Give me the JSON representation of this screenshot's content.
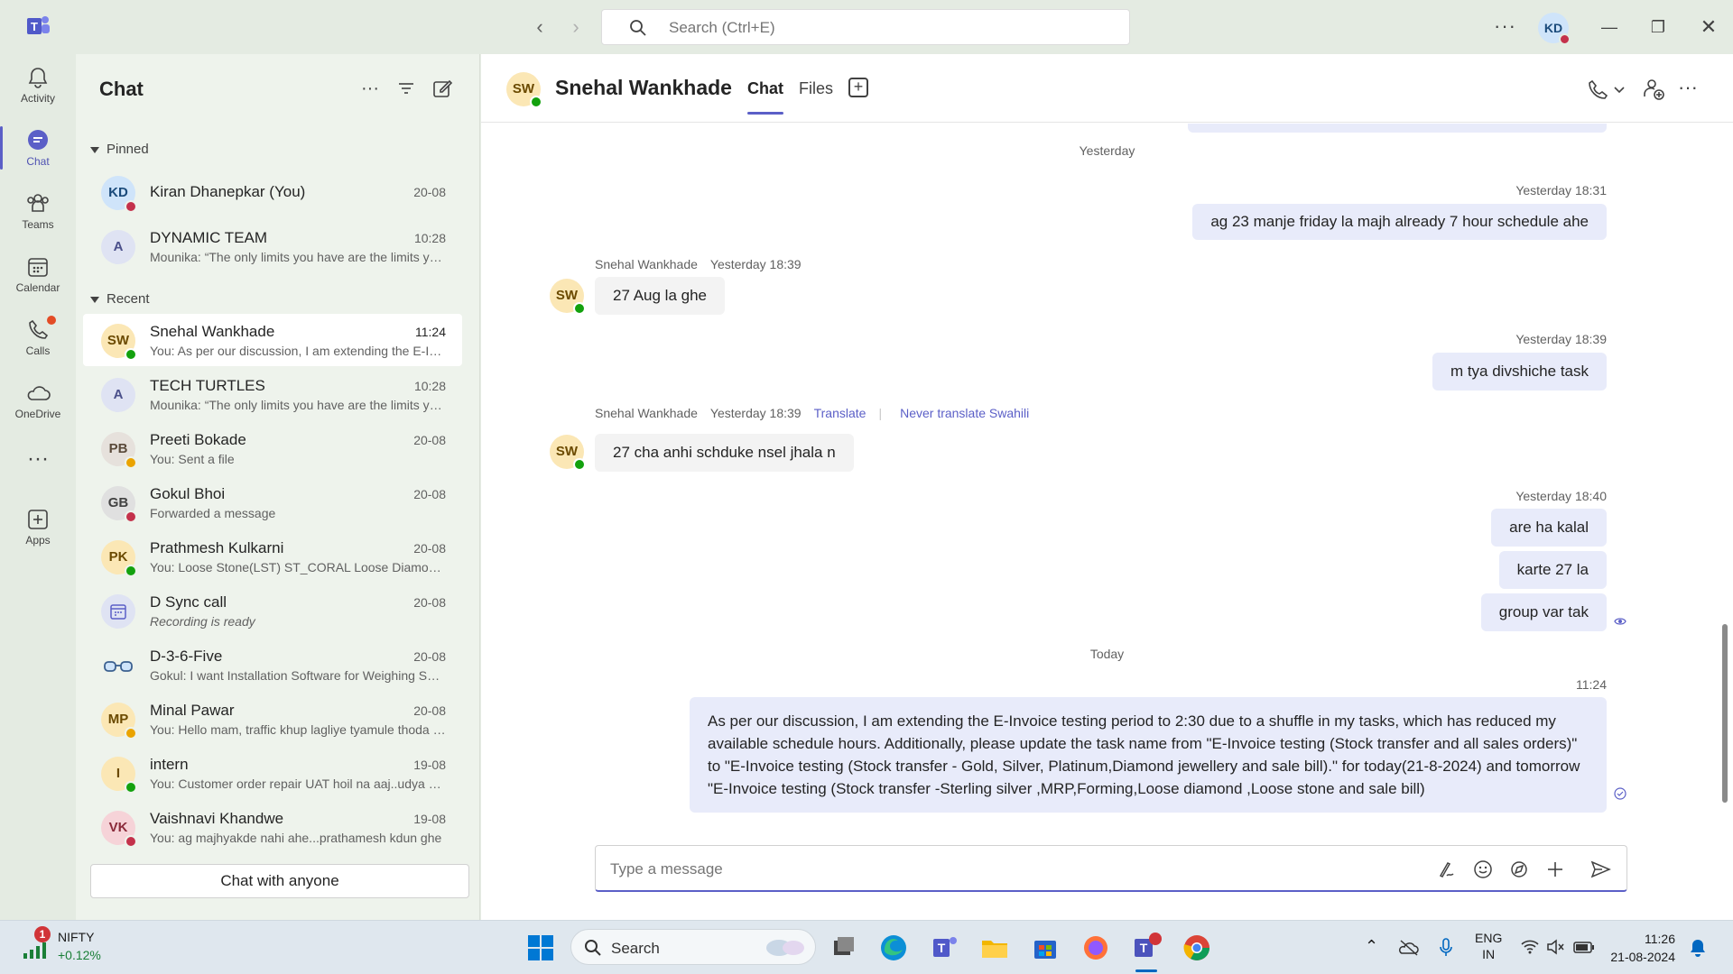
{
  "titlebar": {
    "search_placeholder": "Search (Ctrl+E)",
    "user_initials": "KD"
  },
  "rail": [
    {
      "label": "Activity",
      "icon": "bell-icon"
    },
    {
      "label": "Chat",
      "icon": "chat-icon"
    },
    {
      "label": "Teams",
      "icon": "teams-icon"
    },
    {
      "label": "Calendar",
      "icon": "calendar-icon"
    },
    {
      "label": "Calls",
      "icon": "phone-icon"
    },
    {
      "label": "OneDrive",
      "icon": "cloud-icon"
    },
    {
      "label": "Apps",
      "icon": "apps-icon"
    }
  ],
  "chatlist": {
    "title": "Chat",
    "pinned_label": "Pinned",
    "recent_label": "Recent",
    "chat_anyone": "Chat with anyone",
    "pinned": [
      {
        "initials": "KD",
        "name": "Kiran Dhanepkar (You)",
        "time": "20-08",
        "preview": ""
      },
      {
        "initials": "A",
        "name": "DYNAMIC TEAM",
        "time": "10:28",
        "preview": "Mounika: “The only limits you have are the limits you believe”"
      }
    ],
    "recent": [
      {
        "initials": "SW",
        "name": "Snehal Wankhade",
        "time": "11:24",
        "preview": "You: As per our discussion, I am extending the E-Invoice testing"
      },
      {
        "initials": "A",
        "name": "TECH TURTLES",
        "time": "10:28",
        "preview": "Mounika: “The only limits you have are the limits you believe”"
      },
      {
        "initials": "PB",
        "name": "Preeti Bokade",
        "time": "20-08",
        "preview": "You: Sent a file"
      },
      {
        "initials": "GB",
        "name": "Gokul Bhoi",
        "time": "20-08",
        "preview": "Forwarded a message"
      },
      {
        "initials": "PK",
        "name": "Prathmesh Kulkarni",
        "time": "20-08",
        "preview": "You: Loose Stone(LST) ST_CORAL Loose Diamond(LDM) ST_DIA"
      },
      {
        "initials": "",
        "name": "D Sync call",
        "time": "20-08",
        "preview": "Recording is ready"
      },
      {
        "initials": "",
        "name": "D-3-6-Five",
        "time": "20-08",
        "preview": "Gokul: I want Installation Software for Weighing Scale"
      },
      {
        "initials": "MP",
        "name": "Minal Pawar",
        "time": "20-08",
        "preview": "You: Hello mam, traffic khup lagliye tyamule thoda late hoil"
      },
      {
        "initials": "I",
        "name": "intern",
        "time": "19-08",
        "preview": "You: Customer order repair UAT hoil na aaj..udya sathi"
      },
      {
        "initials": "VK",
        "name": "Vaishnavi Khandwe",
        "time": "19-08",
        "preview": "You: ag majhyakde nahi ahe...prathamesh kdun ghe"
      }
    ]
  },
  "conversation": {
    "contact_initials": "SW",
    "contact_name": "Snehal Wankhade",
    "tabs": [
      "Chat",
      "Files"
    ],
    "date_yesterday": "Yesterday",
    "date_today": "Today",
    "messages": [
      {
        "from": "me",
        "time": "Yesterday 18:31",
        "text": "ag 23 manje friday la majh already 7 hour schedule ahe"
      },
      {
        "from": "them",
        "sender": "Snehal Wankhade",
        "time": "Yesterday 18:39",
        "text": "27 Aug la ghe"
      },
      {
        "from": "me",
        "time": "Yesterday 18:39",
        "text": "m tya divshiche task"
      },
      {
        "from": "them",
        "sender": "Snehal Wankhade",
        "time": "Yesterday 18:39",
        "translate": "Translate",
        "never_translate": "Never translate Swahili",
        "text": "27 cha anhi schduke nsel jhala n"
      },
      {
        "from": "me",
        "time": "Yesterday 18:40",
        "texts": [
          "are ha kalal",
          "karte 27 la",
          "group var tak"
        ]
      },
      {
        "from": "me",
        "time": "11:24",
        "text": "As per our discussion, I am extending the E-Invoice testing period to 2:30 due to a shuffle in my tasks, which has reduced my available schedule hours. Additionally, please update the task name from \"E-Invoice testing (Stock transfer and all sales orders)\" to \"E-Invoice testing (Stock transfer - Gold, Silver, Platinum,Diamond jewellery and sale bill).\" for today(21-8-2024) and tomorrow \"E-Invoice testing (Stock transfer -Sterling silver ,MRP,Forming,Loose diamond ,Loose stone and sale bill)"
      }
    ],
    "compose_placeholder": "Type a message"
  },
  "taskbar": {
    "ticker_name": "NIFTY",
    "ticker_change": "+0.12%",
    "ticker_badge": "1",
    "search_label": "Search",
    "lang_top": "ENG",
    "lang_bottom": "IN",
    "time": "11:26",
    "date": "21-08-2024"
  },
  "colors": {
    "accent": "#5b5fc7",
    "presence_available": "#13a10e",
    "presence_busy": "#c4314b",
    "presence_away": "#eaa300",
    "my_bubble": "#e8ebfa"
  }
}
